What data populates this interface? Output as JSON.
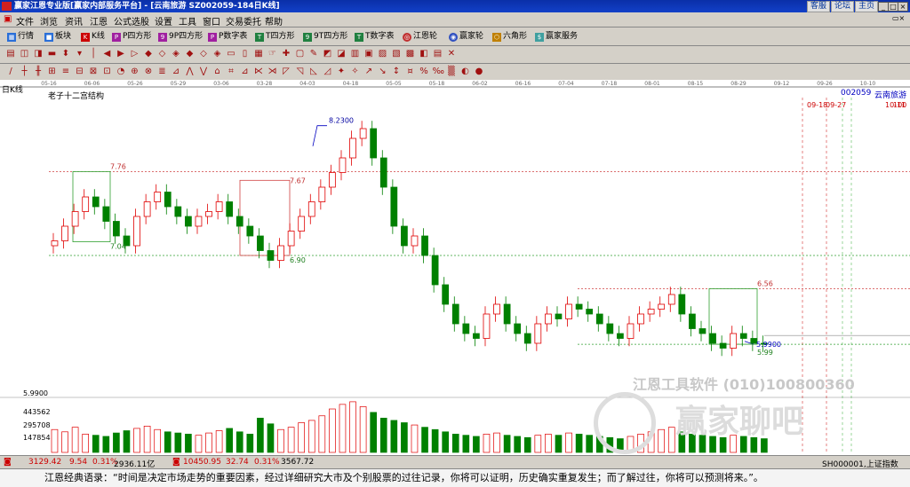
{
  "titlebar": {
    "title": "赢家江恩专业版[赢家内部服务平台] - [云南旅游 SZ002059-184日K线]",
    "links": [
      "客服",
      "论坛",
      "主页"
    ]
  },
  "menu": [
    "文件",
    "浏览",
    "资讯",
    "江恩",
    "公式选股",
    "设置",
    "工具",
    "窗口",
    "交易委托",
    "帮助"
  ],
  "toolbar": [
    {
      "icon": "grid-icon",
      "label": "行情"
    },
    {
      "icon": "blocks-icon",
      "label": "板块"
    },
    {
      "icon": "kline-icon",
      "label": "K线"
    },
    {
      "icon": "p-square-icon",
      "label": "P四方形"
    },
    {
      "icon": "9p-square-icon",
      "label": "9P四方形"
    },
    {
      "icon": "p-number-icon",
      "label": "P数字表"
    },
    {
      "icon": "t-square-icon",
      "label": "T四方形"
    },
    {
      "icon": "9t-square-icon",
      "label": "9T四方形"
    },
    {
      "icon": "t-number-icon",
      "label": "T数字表"
    },
    {
      "icon": "gann-wheel-icon",
      "label": "江恩轮"
    },
    {
      "icon": "winner-wheel-icon",
      "label": "赢家轮"
    },
    {
      "icon": "hexagon-icon",
      "label": "六角形"
    },
    {
      "icon": "service-icon",
      "label": "赢家服务"
    }
  ],
  "chart_header": {
    "period": "日K线",
    "indicator": "老子十二宫结构",
    "code": "002059",
    "name": "云南旅游"
  },
  "date_ticks": [
    "05-16",
    "06-06",
    "05-26",
    "05-29",
    "03-06",
    "03-28",
    "04-03",
    "04-18",
    "05-05",
    "05-18",
    "06-02",
    "06-16",
    "07-04",
    "07-18",
    "08-01",
    "08-15",
    "08-29",
    "09-12",
    "09-26",
    "10-10"
  ],
  "future_labels": [
    "09-18",
    "09-27",
    "10-11",
    "100"
  ],
  "price_annotations": [
    "8.2300",
    "7.76",
    "7.67",
    "7.04",
    "6.90",
    "6.56",
    "5.9900",
    "5.99"
  ],
  "volume_labels": [
    "5.9900",
    "443562",
    "295708",
    "147854"
  ],
  "watermark": {
    "line1": "江恩工具软件 (010)100800360",
    "line2": "赢家聊吧"
  },
  "chart_data": {
    "type": "candlestick",
    "title": "",
    "ylim": [
      5.5,
      8.5
    ],
    "up_color": "#e00000",
    "down_color": "#008000",
    "note": "approximate price path read from chart",
    "key_levels": [
      7.76,
      7.67,
      7.04,
      6.9,
      6.56,
      5.99,
      8.23
    ],
    "closes": [
      7.05,
      7.2,
      7.35,
      7.5,
      7.4,
      7.25,
      7.1,
      7.0,
      7.3,
      7.45,
      7.55,
      7.4,
      7.3,
      7.2,
      7.3,
      7.35,
      7.45,
      7.3,
      7.2,
      7.1,
      6.95,
      6.85,
      7.0,
      7.15,
      7.3,
      7.45,
      7.6,
      7.75,
      7.9,
      8.1,
      8.2,
      7.9,
      7.6,
      7.2,
      7.0,
      7.1,
      6.9,
      6.6,
      6.4,
      6.2,
      6.1,
      6.05,
      6.3,
      6.4,
      6.2,
      6.1,
      6.0,
      6.2,
      6.3,
      6.25,
      6.4,
      6.35,
      6.3,
      6.2,
      6.1,
      6.05,
      6.2,
      6.3,
      6.35,
      6.4,
      6.5,
      6.3,
      6.15,
      6.1,
      6.0,
      5.95,
      6.1,
      6.05,
      6.0,
      5.99
    ],
    "volumes": [
      200,
      180,
      220,
      160,
      150,
      140,
      170,
      190,
      210,
      230,
      200,
      180,
      170,
      160,
      150,
      170,
      190,
      210,
      180,
      160,
      300,
      250,
      200,
      220,
      260,
      280,
      320,
      380,
      420,
      443,
      400,
      350,
      300,
      280,
      260,
      240,
      220,
      200,
      180,
      160,
      150,
      140,
      160,
      170,
      150,
      140,
      130,
      150,
      160,
      150,
      170,
      160,
      150,
      140,
      130,
      120,
      140,
      160,
      180,
      200,
      220,
      180,
      160,
      150,
      140,
      130,
      150,
      140,
      130,
      120
    ]
  },
  "bottom": {
    "sh": "3129.42",
    "sh_chg": "9.54",
    "sh_pct": "0.31%",
    "sh_amt": "2936.11亿",
    "sz": "10450.95",
    "sz_chg": "32.74",
    "sz_pct": "0.31%",
    "sz_amt": "3567.72",
    "right": "SH000001,上证指数"
  },
  "quote": "江恩经典语录：“时间是决定市场走势的重要因素，经过详细研究大市及个别股票的过往记录，你将可以证明，历史确实重复发生；而了解过往，你将可以预测将来。”。"
}
